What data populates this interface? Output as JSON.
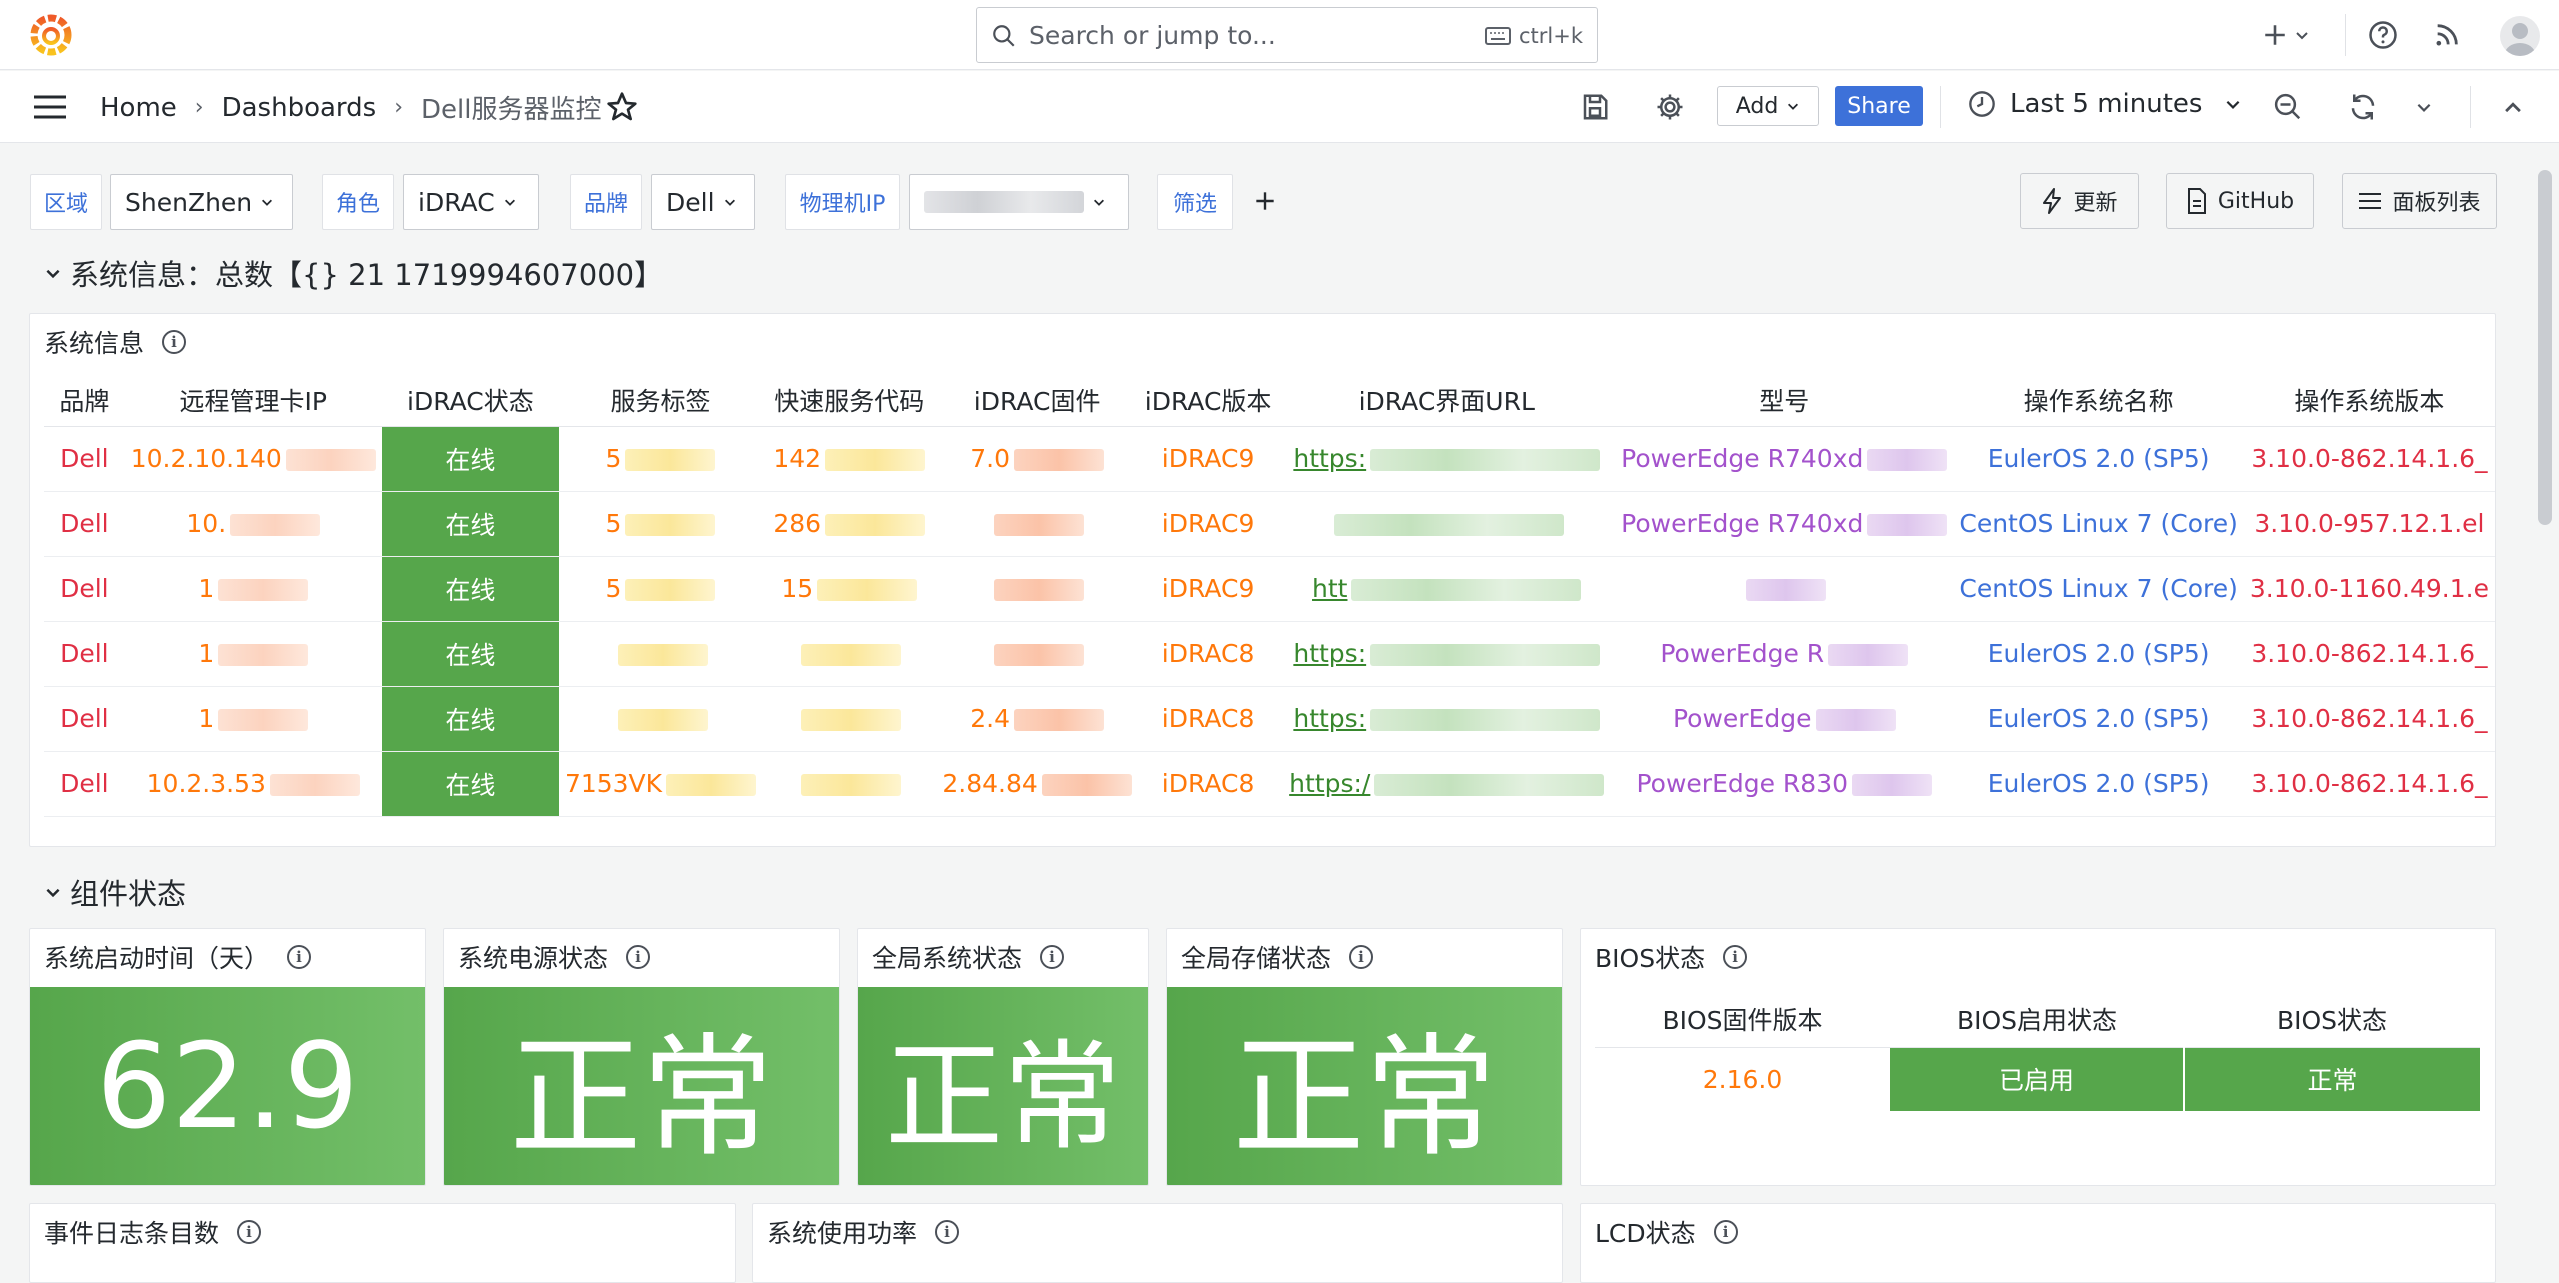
{
  "topbar": {
    "search_placeholder": "Search or jump to...",
    "search_shortcut": "ctrl+k",
    "new_label": "+",
    "icons": [
      "grafana-logo",
      "plus-icon",
      "help-icon",
      "rss-icon",
      "avatar"
    ]
  },
  "breadcrumb": {
    "items": [
      "Home",
      "Dashboards",
      "Dell服务器监控"
    ]
  },
  "toolbar": {
    "add_label": "Add",
    "share_label": "Share",
    "time_range": "Last 5 minutes"
  },
  "variables": [
    {
      "label": "区域",
      "value": "ShenZhen"
    },
    {
      "label": "角色",
      "value": "iDRAC"
    },
    {
      "label": "品牌",
      "value": "Dell"
    },
    {
      "label": "物理机IP",
      "value": ""
    },
    {
      "label": "筛选",
      "value": ""
    }
  ],
  "right_buttons": {
    "update": "更新",
    "github": "GitHub",
    "panel_list": "面板列表"
  },
  "rows": {
    "system": "系统信息：总数【{} 21 1719994607000】",
    "component": "组件状态"
  },
  "system_panel": {
    "title": "系统信息",
    "columns": [
      "品牌",
      "远程管理卡IP",
      "iDRAC状态",
      "服务标签",
      "快速服务代码",
      "iDRAC固件",
      "iDRAC版本",
      "iDRAC界面URL",
      "型号",
      "操作系统名称",
      "操作系统版本"
    ],
    "rows": [
      {
        "brand": "Dell",
        "ip": "10.2.10.140",
        "status": "在线",
        "tag": "5",
        "code": "142",
        "fw": "7.0",
        "ver": "iDRAC9",
        "url": "https:",
        "model": "PowerEdge R740xd",
        "os": "EulerOS 2.0 (SP5)",
        "osver": "3.10.0-862.14.1.6_"
      },
      {
        "brand": "Dell",
        "ip": "10.",
        "status": "在线",
        "tag": "5",
        "code": "286",
        "fw": "",
        "ver": "iDRAC9",
        "url": "",
        "model": "PowerEdge R740xd",
        "os": "CentOS Linux 7 (Core)",
        "osver": "3.10.0-957.12.1.el"
      },
      {
        "brand": "Dell",
        "ip": "1",
        "status": "在线",
        "tag": "5",
        "code": "15",
        "fw": "",
        "ver": "iDRAC9",
        "url": "htt",
        "model": "",
        "os": "CentOS Linux 7 (Core)",
        "osver": "3.10.0-1160.49.1.e"
      },
      {
        "brand": "Dell",
        "ip": "1",
        "status": "在线",
        "tag": "",
        "code": "",
        "fw": "",
        "ver": "iDRAC8",
        "url": "https:",
        "model": "PowerEdge R",
        "os": "EulerOS 2.0 (SP5)",
        "osver": "3.10.0-862.14.1.6_"
      },
      {
        "brand": "Dell",
        "ip": "1",
        "status": "在线",
        "tag": "",
        "code": "",
        "fw": "2.4",
        "ver": "iDRAC8",
        "url": "https:",
        "model": "PowerEdge",
        "os": "EulerOS 2.0 (SP5)",
        "osver": "3.10.0-862.14.1.6_"
      },
      {
        "brand": "Dell",
        "ip": "10.2.3.53",
        "status": "在线",
        "tag": "7153VK",
        "code": "",
        "fw": "2.84.84",
        "ver": "iDRAC8",
        "url": "https:/",
        "model": "PowerEdge R830",
        "os": "EulerOS 2.0 (SP5)",
        "osver": "3.10.0-862.14.1.6_"
      }
    ]
  },
  "stats": {
    "uptime_title": "系统启动时间（天）",
    "uptime_value": "62.9",
    "power_title": "系统电源状态",
    "power_value": "正常",
    "global_title": "全局系统状态",
    "global_value": "正常",
    "storage_title": "全局存储状态",
    "storage_value": "正常"
  },
  "bios": {
    "title": "BIOS状态",
    "columns": [
      "BIOS固件版本",
      "BIOS启用状态",
      "BIOS状态"
    ],
    "firmware": "2.16.0",
    "enabled": "已启用",
    "status": "正常"
  },
  "bottom_panels": {
    "event_log": "事件日志条目数",
    "power_usage": "系统使用功率",
    "lcd": "LCD状态"
  },
  "colors": {
    "green": "#56a64b",
    "blue": "#3d71d9",
    "red": "#e02f44",
    "orange": "#ff780a",
    "purple": "#a352cc"
  }
}
